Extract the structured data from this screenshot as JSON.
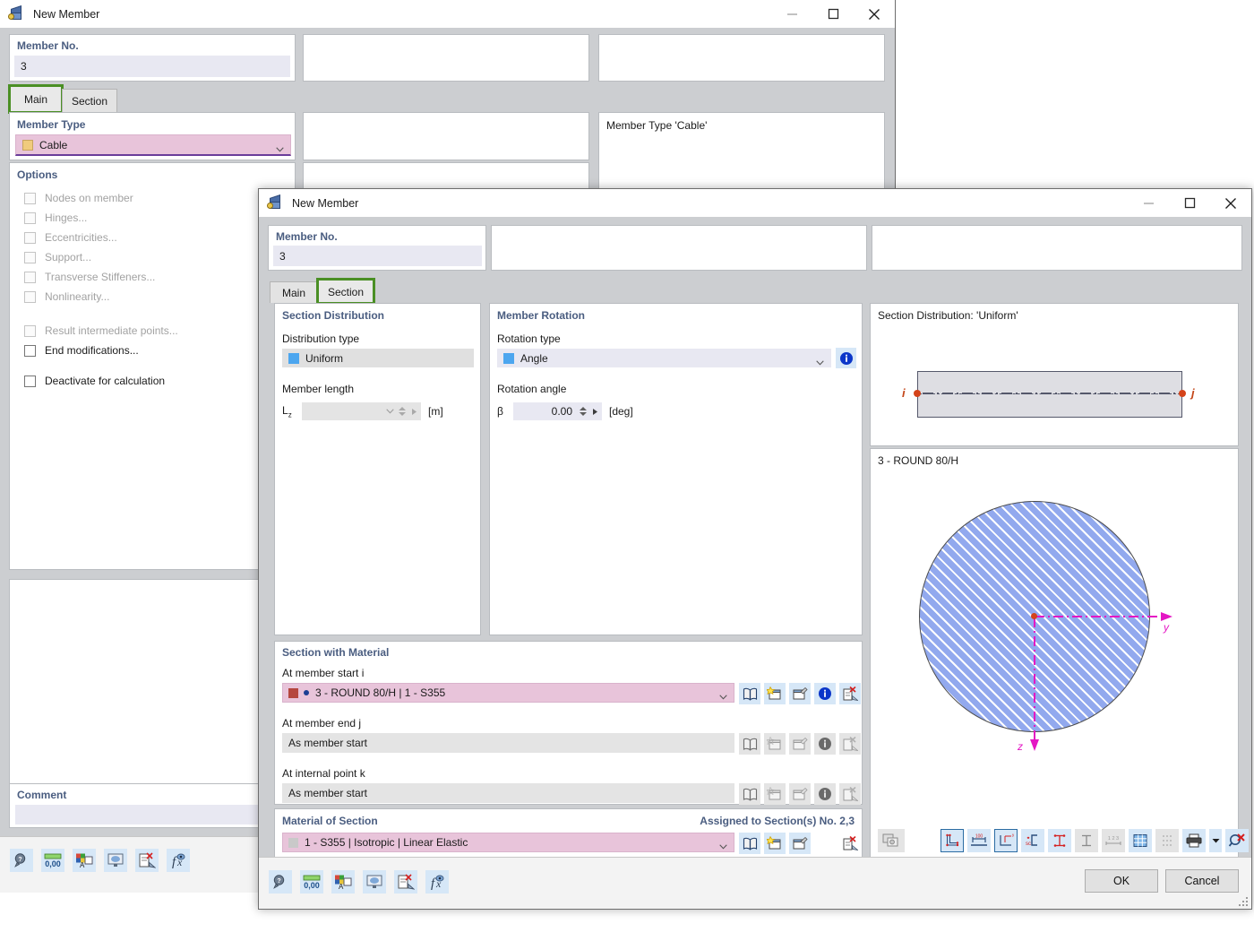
{
  "window_back": {
    "title": "New Member",
    "icon": "member-cube-icon",
    "buttons": {
      "minimize": "minimize-icon",
      "maximize": "maximize-icon",
      "close": "close-icon"
    },
    "member_no": {
      "label": "Member No.",
      "value": "3"
    },
    "tabs": [
      {
        "id": "main",
        "label": "Main",
        "selected": true
      },
      {
        "id": "section",
        "label": "Section",
        "selected": false
      }
    ],
    "member_type": {
      "group_label": "Member Type",
      "value": "Cable",
      "swatch_color": "#f0cb7d",
      "field_color": "#e8c4da",
      "underline_color": "#6a3d9a"
    },
    "options": {
      "group_label": "Options",
      "items": [
        {
          "label": "Nodes on member",
          "checked": false,
          "enabled": false
        },
        {
          "label": "Hinges...",
          "checked": false,
          "enabled": false
        },
        {
          "label": "Eccentricities...",
          "checked": false,
          "enabled": false
        },
        {
          "label": "Support...",
          "checked": false,
          "enabled": false
        },
        {
          "label": "Transverse Stiffeners...",
          "checked": false,
          "enabled": false
        },
        {
          "label": "Nonlinearity...",
          "checked": false,
          "enabled": false
        },
        {
          "label": "Result intermediate points...",
          "checked": false,
          "enabled": false
        },
        {
          "label": "End modifications...",
          "checked": false,
          "enabled": true
        },
        {
          "label": "Deactivate for calculation",
          "checked": false,
          "enabled": true
        }
      ]
    },
    "comment": {
      "label": "Comment",
      "value": ""
    },
    "info_panel": {
      "text": "Member Type 'Cable'"
    },
    "bottom_toolbar": [
      "help-search-icon",
      "units-decimals-icon",
      "display-properties-icon",
      "view-mode-icon",
      "reset-settings-icon",
      "formula-icon"
    ]
  },
  "window_front": {
    "title": "New Member",
    "icon": "member-cube-icon",
    "buttons": {
      "minimize": "minimize-icon",
      "maximize": "maximize-icon",
      "close": "close-icon"
    },
    "member_no": {
      "label": "Member No.",
      "value": "3"
    },
    "tabs": [
      {
        "id": "main",
        "label": "Main",
        "selected": false
      },
      {
        "id": "section",
        "label": "Section",
        "selected": true
      }
    ],
    "section_distribution": {
      "group_label": "Section Distribution",
      "distribution_type_label": "Distribution type",
      "distribution_type_value": "Uniform",
      "distribution_swatch_color": "#4ca6ef",
      "member_length_label": "Member length",
      "member_length_symbol": "L",
      "member_length_subscript": "z",
      "member_length_value": "",
      "member_length_unit": "[m]"
    },
    "member_rotation": {
      "group_label": "Member Rotation",
      "rotation_type_label": "Rotation type",
      "rotation_type_value": "Angle",
      "rotation_swatch_color": "#4ca6ef",
      "info_icon": "info-icon",
      "rotation_angle_label": "Rotation angle",
      "rotation_angle_symbol": "β",
      "rotation_angle_value": "0.00",
      "rotation_angle_unit": "[deg]"
    },
    "section_with_material": {
      "group_label": "Section with Material",
      "rows": [
        {
          "label": "At member start i",
          "value": "3 - ROUND 80/H | 1 - S355",
          "swatch_color": "#b5473f",
          "bullet_color": "#1c3f94",
          "enabled": true,
          "icons": [
            "library-icon",
            "new-section-icon",
            "edit-section-icon",
            "info-icon",
            "delete-section-icon"
          ]
        },
        {
          "label": "At member end j",
          "value": "As member start",
          "enabled": false,
          "icons": [
            "library-icon",
            "new-section-icon",
            "edit-section-icon",
            "info-icon",
            "delete-section-icon"
          ]
        },
        {
          "label": "At internal point k",
          "value": "As member start",
          "enabled": false,
          "icons": [
            "library-icon",
            "new-section-icon",
            "edit-section-icon",
            "info-icon",
            "delete-section-icon"
          ]
        }
      ]
    },
    "material_of_section": {
      "group_label": "Material of Section",
      "assigned_text": "Assigned to Section(s) No. 2,3",
      "value": "1 - S355 | Isotropic | Linear Elastic",
      "swatch_color": "#c9c9c9",
      "icons": [
        "library-icon",
        "new-material-icon",
        "edit-material-icon",
        "delete-material-icon"
      ]
    },
    "preview": {
      "distribution_caption": "Section Distribution: 'Uniform'",
      "node_i_label": "i",
      "node_j_label": "j",
      "section_caption": "3 - ROUND 80/H",
      "axis_y_label": "y",
      "axis_z_label": "z",
      "snapshot_icon": "snapshot-icon",
      "toolbar": [
        {
          "icon": "section-outline-icon",
          "state": "selected"
        },
        {
          "icon": "dimensions-icon",
          "state": "on"
        },
        {
          "icon": "axes-icon",
          "state": "selected"
        },
        {
          "icon": "shear-center-icon",
          "state": "on"
        },
        {
          "icon": "stress-points-icon",
          "state": "on"
        },
        {
          "icon": "section-plain-icon",
          "state": "off"
        },
        {
          "icon": "numbering-icon",
          "state": "off"
        },
        {
          "icon": "grid-icon",
          "state": "on"
        },
        {
          "icon": "mesh-points-icon",
          "state": "off"
        },
        {
          "icon": "print-icon",
          "state": "on"
        },
        {
          "icon": "print-dropdown-icon",
          "state": "on"
        },
        {
          "icon": "zoom-reset-icon",
          "state": "on"
        }
      ]
    },
    "bottom_toolbar": [
      "help-search-icon",
      "units-decimals-icon",
      "display-properties-icon",
      "view-mode-icon",
      "reset-settings-icon",
      "formula-icon"
    ],
    "ok_label": "OK",
    "cancel_label": "Cancel"
  },
  "colors": {
    "accent_selected_tab": "#4a8f24",
    "group_title": "#4a5d80",
    "pink_field": "#e8c4da",
    "lavender_field": "#e8e8f2",
    "icon_blue_bg": "#d6e7f7",
    "axis_magenta": "#e417c4",
    "node_red": "#d4431a",
    "hatch_blue": "#92a9ee"
  }
}
